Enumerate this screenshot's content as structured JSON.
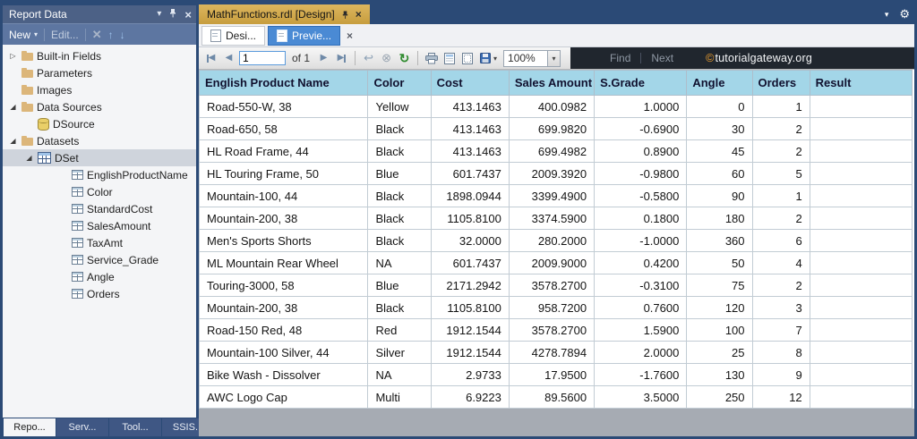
{
  "colors": {
    "chrome": "#2b4a76",
    "panel-header": "#4c6186",
    "panel-toolbar": "#5d76a1",
    "doc-tab-gold": "#c79d3e",
    "doc-tab-gold-light": "#dcb65e",
    "preview-tab-blue": "#4a8ad4",
    "table-header-blue": "#a3d6e8",
    "watermark-bg": "#20262e",
    "accent-green": "#2e8b2e"
  },
  "reportData": {
    "title": "Report Data",
    "toolbar": {
      "new": "New",
      "edit": "Edit..."
    },
    "tree": [
      {
        "label": "Built-in Fields",
        "type": "folder",
        "level": 0,
        "expander": "collapsed"
      },
      {
        "label": "Parameters",
        "type": "folder",
        "level": 0
      },
      {
        "label": "Images",
        "type": "folder",
        "level": 0
      },
      {
        "label": "Data Sources",
        "type": "folder",
        "level": 0,
        "expander": "expanded"
      },
      {
        "label": "DSource",
        "type": "datasource",
        "level": 1
      },
      {
        "label": "Datasets",
        "type": "folder",
        "level": 0,
        "expander": "expanded"
      },
      {
        "label": "DSet",
        "type": "dataset",
        "level": 1,
        "expander": "expanded",
        "selected": true
      },
      {
        "label": "EnglishProductName",
        "type": "field",
        "level": 2
      },
      {
        "label": "Color",
        "type": "field",
        "level": 2
      },
      {
        "label": "StandardCost",
        "type": "field",
        "level": 2
      },
      {
        "label": "SalesAmount",
        "type": "field",
        "level": 2
      },
      {
        "label": "TaxAmt",
        "type": "field",
        "level": 2
      },
      {
        "label": "Service_Grade",
        "type": "field",
        "level": 2
      },
      {
        "label": "Angle",
        "type": "field",
        "level": 2
      },
      {
        "label": "Orders",
        "type": "field",
        "level": 2
      }
    ],
    "bottomTabs": [
      {
        "label": "Repo...",
        "active": true
      },
      {
        "label": "Serv...",
        "active": false
      },
      {
        "label": "Tool...",
        "active": false
      },
      {
        "label": "SSIS...",
        "active": false
      }
    ]
  },
  "document": {
    "tabTitle": "MathFunctions.rdl [Design]",
    "viewTabs": {
      "design": "Desi...",
      "preview": "Previe..."
    },
    "toolbar": {
      "page": "1",
      "ofLabel": "of 1",
      "zoom": "100%",
      "find": "Find",
      "next": "Next",
      "watermarkSymbol": "©",
      "watermarkText": "tutorialgateway.org"
    },
    "table": {
      "columns": [
        "English Product Name",
        "Color",
        "Cost",
        "Sales Amount",
        "S.Grade",
        "Angle",
        "Orders",
        "Result"
      ],
      "rows": [
        [
          "Road-550-W, 38",
          "Yellow",
          "413.1463",
          "400.0982",
          "1.0000",
          "0",
          "1",
          ""
        ],
        [
          "Road-650, 58",
          "Black",
          "413.1463",
          "699.9820",
          "-0.6900",
          "30",
          "2",
          ""
        ],
        [
          "HL Road Frame, 44",
          "Black",
          "413.1463",
          "699.4982",
          "0.8900",
          "45",
          "2",
          ""
        ],
        [
          "HL Touring Frame, 50",
          "Blue",
          "601.7437",
          "2009.3920",
          "-0.9800",
          "60",
          "5",
          ""
        ],
        [
          "Mountain-100, 44",
          "Black",
          "1898.0944",
          "3399.4900",
          "-0.5800",
          "90",
          "1",
          ""
        ],
        [
          "Mountain-200, 38",
          "Black",
          "1105.8100",
          "3374.5900",
          "0.1800",
          "180",
          "2",
          ""
        ],
        [
          "Men's Sports Shorts",
          "Black",
          "32.0000",
          "280.2000",
          "-1.0000",
          "360",
          "6",
          ""
        ],
        [
          "ML Mountain Rear Wheel",
          "NA",
          "601.7437",
          "2009.9000",
          "0.4200",
          "50",
          "4",
          ""
        ],
        [
          "Touring-3000, 58",
          "Blue",
          "2171.2942",
          "3578.2700",
          "-0.3100",
          "75",
          "2",
          ""
        ],
        [
          "Mountain-200, 38",
          "Black",
          "1105.8100",
          "958.7200",
          "0.7600",
          "120",
          "3",
          ""
        ],
        [
          "Road-150 Red, 48",
          "Red",
          "1912.1544",
          "3578.2700",
          "1.5900",
          "100",
          "7",
          ""
        ],
        [
          "Mountain-100 Silver, 44",
          "Silver",
          "1912.1544",
          "4278.7894",
          "2.0000",
          "25",
          "8",
          ""
        ],
        [
          "Bike Wash - Dissolver",
          "NA",
          "2.9733",
          "17.9500",
          "-1.7600",
          "130",
          "9",
          ""
        ],
        [
          "AWC Logo Cap",
          "Multi",
          "6.9223",
          "89.5600",
          "3.5000",
          "250",
          "12",
          ""
        ]
      ]
    }
  }
}
